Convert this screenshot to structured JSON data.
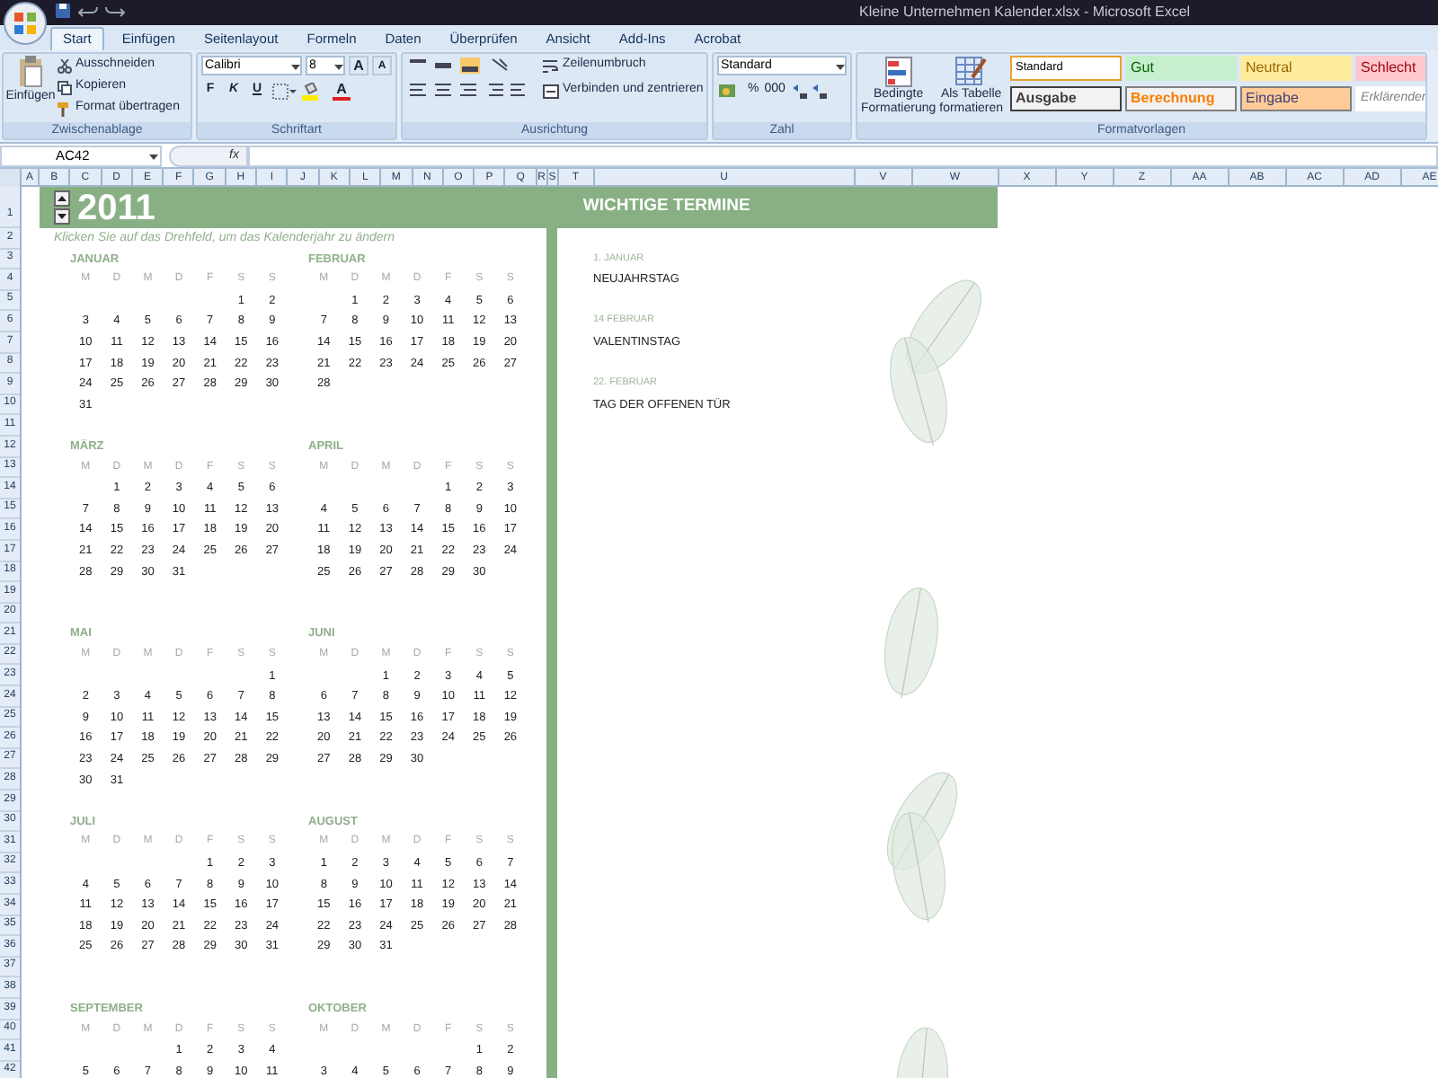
{
  "window": {
    "title": "Kleine Unternehmen Kalender.xlsx - Microsoft Excel"
  },
  "tabs": [
    {
      "label": "Start",
      "selected": true
    },
    {
      "label": "Einfügen",
      "selected": false
    },
    {
      "label": "Seitenlayout",
      "selected": false
    },
    {
      "label": "Formeln",
      "selected": false
    },
    {
      "label": "Daten",
      "selected": false
    },
    {
      "label": "Überprüfen",
      "selected": false
    },
    {
      "label": "Ansicht",
      "selected": false
    },
    {
      "label": "Add-Ins",
      "selected": false
    },
    {
      "label": "Acrobat",
      "selected": false
    }
  ],
  "ribbon": {
    "clipboard": {
      "label": "Zwischenablage",
      "paste": "Einfügen",
      "cut": "Ausschneiden",
      "copy": "Kopieren",
      "format_painter": "Format übertragen"
    },
    "font": {
      "label": "Schriftart",
      "font_name": "Calibri",
      "font_size": "8",
      "grow": "A",
      "shrink": "A",
      "bold": "F",
      "italic": "K",
      "underline": "U",
      "font_color": "A"
    },
    "alignment": {
      "label": "Ausrichtung",
      "wrap_text": "Zeilenumbruch",
      "merge_center": "Verbinden und zentrieren"
    },
    "number": {
      "label": "Zahl",
      "format": "Standard",
      "percent": "%",
      "thousands": "000"
    },
    "styles": {
      "label": "Formatvorlagen",
      "conditional": "Bedingte Formatierung",
      "as_table": "Als Tabelle formatieren",
      "cells": [
        {
          "label": "Standard",
          "kind": "normal"
        },
        {
          "label": "Gut",
          "kind": "good"
        },
        {
          "label": "Neutral",
          "kind": "neutral"
        },
        {
          "label": "Schlecht",
          "kind": "bad"
        },
        {
          "label": "Ausgabe",
          "kind": "output"
        },
        {
          "label": "Berechnung",
          "kind": "calculation"
        },
        {
          "label": "Eingabe",
          "kind": "input"
        },
        {
          "label": "Erklärender",
          "kind": "explanatory"
        }
      ]
    }
  },
  "formula_bar": {
    "name_box": "AC42",
    "fx": "fx"
  },
  "columns": [
    "A",
    "B",
    "C",
    "D",
    "E",
    "F",
    "G",
    "H",
    "I",
    "J",
    "K",
    "L",
    "M",
    "N",
    "O",
    "P",
    "Q",
    "R",
    "S",
    "T",
    "U",
    "V",
    "W",
    "X",
    "Y",
    "Z",
    "AA",
    "AB",
    "AC",
    "AD",
    "AE"
  ],
  "rows": [
    "1",
    "2",
    "3",
    "4",
    "5",
    "6",
    "7",
    "8",
    "9",
    "10",
    "11",
    "12",
    "13",
    "14",
    "15",
    "16",
    "17",
    "18",
    "19",
    "20",
    "21",
    "22",
    "23",
    "24",
    "25",
    "26",
    "27",
    "28",
    "29",
    "30",
    "31",
    "32",
    "33",
    "34",
    "35",
    "36",
    "37",
    "38",
    "39",
    "40",
    "41",
    "42"
  ],
  "calendar": {
    "year": "2011",
    "hint": "Klicken Sie auf das Drehfeld,  um das Kalenderjahr zu ändern",
    "months": [
      {
        "name": "JANUAR",
        "weekdays": [
          "M",
          "D",
          "M",
          "D",
          "F",
          "S",
          "S"
        ],
        "weeks": [
          {
            "sat": "1",
            "sun": "2"
          },
          {
            "mon": "3",
            "tue": "4",
            "wed": "5",
            "thu": "6",
            "fri": "7",
            "sat": "8",
            "sun": "9"
          },
          {
            "mon": "10",
            "tue": "11",
            "wed": "12",
            "thu": "13",
            "fri": "14",
            "sat": "15",
            "sun": "16"
          },
          {
            "mon": "17",
            "tue": "18",
            "wed": "19",
            "thu": "20",
            "fri": "21",
            "sat": "22",
            "sun": "23"
          },
          {
            "mon": "24",
            "tue": "25",
            "wed": "26",
            "thu": "27",
            "fri": "28",
            "sat": "29",
            "sun": "30"
          },
          {
            "mon": "31"
          }
        ]
      },
      {
        "name": "FEBRUAR",
        "weekdays": [
          "M",
          "D",
          "M",
          "D",
          "F",
          "S",
          "S"
        ],
        "weeks": [
          {
            "tue": "1",
            "wed": "2",
            "thu": "3",
            "fri": "4",
            "sat": "5",
            "sun": "6"
          },
          {
            "mon": "7",
            "tue": "8",
            "wed": "9",
            "thu": "10",
            "fri": "11",
            "sat": "12",
            "sun": "13"
          },
          {
            "mon": "14",
            "tue": "15",
            "wed": "16",
            "thu": "17",
            "fri": "18",
            "sat": "19",
            "sun": "20"
          },
          {
            "mon": "21",
            "tue": "22",
            "wed": "23",
            "thu": "24",
            "fri": "25",
            "sat": "26",
            "sun": "27"
          },
          {
            "mon": "28"
          }
        ]
      },
      {
        "name": "MÄRZ",
        "weekdays": [
          "M",
          "D",
          "M",
          "D",
          "F",
          "S",
          "S"
        ],
        "weeks": [
          {
            "tue": "1",
            "wed": "2",
            "thu": "3",
            "fri": "4",
            "sat": "5",
            "sun": "6"
          },
          {
            "mon": "7",
            "tue": "8",
            "wed": "9",
            "thu": "10",
            "fri": "11",
            "sat": "12",
            "sun": "13"
          },
          {
            "mon": "14",
            "tue": "15",
            "wed": "16",
            "thu": "17",
            "fri": "18",
            "sat": "19",
            "sun": "20"
          },
          {
            "mon": "21",
            "tue": "22",
            "wed": "23",
            "thu": "24",
            "fri": "25",
            "sat": "26",
            "sun": "27"
          },
          {
            "mon": "28",
            "tue": "29",
            "wed": "30",
            "thu": "31"
          }
        ]
      },
      {
        "name": "APRIL",
        "weekdays": [
          "M",
          "D",
          "M",
          "D",
          "F",
          "S",
          "S"
        ],
        "weeks": [
          {
            "fri": "1",
            "sat": "2",
            "sun": "3"
          },
          {
            "mon": "4",
            "tue": "5",
            "wed": "6",
            "thu": "7",
            "fri": "8",
            "sat": "9",
            "sun": "10"
          },
          {
            "mon": "11",
            "tue": "12",
            "wed": "13",
            "thu": "14",
            "fri": "15",
            "sat": "16",
            "sun": "17"
          },
          {
            "mon": "18",
            "tue": "19",
            "wed": "20",
            "thu": "21",
            "fri": "22",
            "sat": "23",
            "sun": "24"
          },
          {
            "mon": "25",
            "tue": "26",
            "wed": "27",
            "thu": "28",
            "fri": "29",
            "sat": "30"
          }
        ]
      },
      {
        "name": "MAI",
        "weekdays": [
          "M",
          "D",
          "M",
          "D",
          "F",
          "S",
          "S"
        ],
        "weeks": [
          {
            "sun": "1"
          },
          {
            "mon": "2",
            "tue": "3",
            "wed": "4",
            "thu": "5",
            "fri": "6",
            "sat": "7",
            "sun": "8"
          },
          {
            "mon": "9",
            "tue": "10",
            "wed": "11",
            "thu": "12",
            "fri": "13",
            "sat": "14",
            "sun": "15"
          },
          {
            "mon": "16",
            "tue": "17",
            "wed": "18",
            "thu": "19",
            "fri": "20",
            "sat": "21",
            "sun": "22"
          },
          {
            "mon": "23",
            "tue": "24",
            "wed": "25",
            "thu": "26",
            "fri": "27",
            "sat": "28",
            "sun": "29"
          },
          {
            "mon": "30",
            "tue": "31"
          }
        ]
      },
      {
        "name": "JUNI",
        "weekdays": [
          "M",
          "D",
          "M",
          "D",
          "F",
          "S",
          "S"
        ],
        "weeks": [
          {
            "wed": "1",
            "thu": "2",
            "fri": "3",
            "sat": "4",
            "sun": "5"
          },
          {
            "mon": "6",
            "tue": "7",
            "wed": "8",
            "thu": "9",
            "fri": "10",
            "sat": "11",
            "sun": "12"
          },
          {
            "mon": "13",
            "tue": "14",
            "wed": "15",
            "thu": "16",
            "fri": "17",
            "sat": "18",
            "sun": "19"
          },
          {
            "mon": "20",
            "tue": "21",
            "wed": "22",
            "thu": "23",
            "fri": "24",
            "sat": "25",
            "sun": "26"
          },
          {
            "mon": "27",
            "tue": "28",
            "wed": "29",
            "thu": "30"
          }
        ]
      },
      {
        "name": "JULI",
        "weekdays": [
          "M",
          "D",
          "M",
          "D",
          "F",
          "S",
          "S"
        ],
        "weeks": [
          {
            "fri": "1",
            "sat": "2",
            "sun": "3"
          },
          {
            "mon": "4",
            "tue": "5",
            "wed": "6",
            "thu": "7",
            "fri": "8",
            "sat": "9",
            "sun": "10"
          },
          {
            "mon": "11",
            "tue": "12",
            "wed": "13",
            "thu": "14",
            "fri": "15",
            "sat": "16",
            "sun": "17"
          },
          {
            "mon": "18",
            "tue": "19",
            "wed": "20",
            "thu": "21",
            "fri": "22",
            "sat": "23",
            "sun": "24"
          },
          {
            "mon": "25",
            "tue": "26",
            "wed": "27",
            "thu": "28",
            "fri": "29",
            "sat": "30",
            "sun": "31"
          }
        ]
      },
      {
        "name": "AUGUST",
        "weekdays": [
          "M",
          "D",
          "M",
          "D",
          "F",
          "S",
          "S"
        ],
        "weeks": [
          {
            "mon": "1",
            "tue": "2",
            "wed": "3",
            "thu": "4",
            "fri": "5",
            "sat": "6",
            "sun": "7"
          },
          {
            "mon": "8",
            "tue": "9",
            "wed": "10",
            "thu": "11",
            "fri": "12",
            "sat": "13",
            "sun": "14"
          },
          {
            "mon": "15",
            "tue": "16",
            "wed": "17",
            "thu": "18",
            "fri": "19",
            "sat": "20",
            "sun": "21"
          },
          {
            "mon": "22",
            "tue": "23",
            "wed": "24",
            "thu": "25",
            "fri": "26",
            "sat": "27",
            "sun": "28"
          },
          {
            "mon": "29",
            "tue": "30",
            "wed": "31"
          }
        ]
      },
      {
        "name": "SEPTEMBER",
        "weekdays": [
          "M",
          "D",
          "M",
          "D",
          "F",
          "S",
          "S"
        ],
        "weeks": [
          {
            "thu": "1",
            "fri": "2",
            "sat": "3",
            "sun": "4"
          },
          {
            "mon": "5",
            "tue": "6",
            "wed": "7",
            "thu": "8",
            "fri": "9",
            "sat": "10",
            "sun": "11"
          }
        ]
      },
      {
        "name": "OKTOBER",
        "weekdays": [
          "M",
          "D",
          "M",
          "D",
          "F",
          "S",
          "S"
        ],
        "weeks": [
          {
            "sat": "1",
            "sun": "2"
          },
          {
            "mon": "3",
            "tue": "4",
            "wed": "5",
            "thu": "6",
            "fri": "7",
            "sat": "8",
            "sun": "9"
          }
        ]
      }
    ]
  },
  "events": {
    "title": "WICHTIGE TERMINE",
    "items": [
      {
        "date": "1. JANUAR",
        "name": "NEUJAHRSTAG"
      },
      {
        "date": "14 FEBRUAR",
        "name": "VALENTINSTAG"
      },
      {
        "date": "22. FEBRUAR",
        "name": "TAG DER OFFENEN TÜR"
      }
    ]
  }
}
